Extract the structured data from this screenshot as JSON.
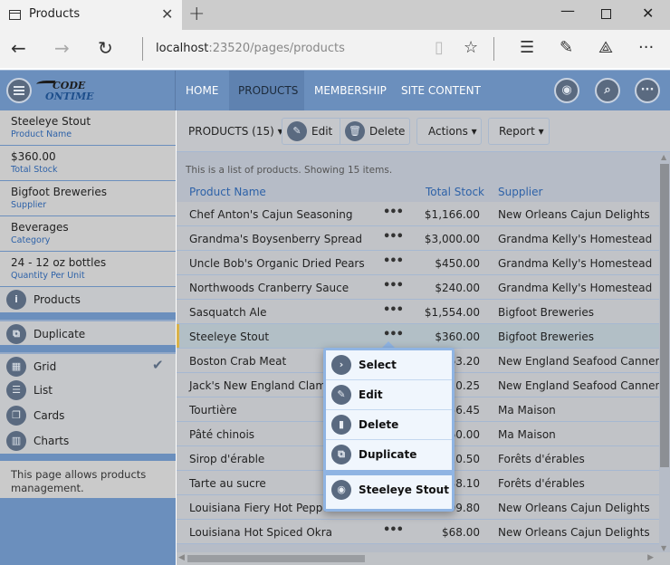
{
  "browser": {
    "tab_title": "Products",
    "tab_close": "✕",
    "new_tab": "+",
    "url_host": "localhost",
    "url_path": ":23520/pages/products",
    "icons": [
      "back-arrow-icon",
      "forward-arrow-icon",
      "refresh-icon",
      "reading-view-icon",
      "favorite-star-icon",
      "hub-icon",
      "web-note-icon",
      "share-icon",
      "more-icon"
    ]
  },
  "header": {
    "logo_line1": "CODE",
    "logo_line2": "ONTIME",
    "nav": [
      {
        "label": "HOME",
        "active": false
      },
      {
        "label": "PRODUCTS",
        "active": true
      },
      {
        "label": "MEMBERSHIP",
        "active": false
      },
      {
        "label": "SITE CONTENT",
        "active": false
      }
    ]
  },
  "sidebar": {
    "fields": [
      {
        "value": "Steeleye Stout",
        "label": "Product Name"
      },
      {
        "value": "$360.00",
        "label": "Total Stock"
      },
      {
        "value": "Bigfoot Breweries",
        "label": "Supplier"
      },
      {
        "value": "Beverages",
        "label": "Category"
      },
      {
        "value": "24 - 12 oz bottles",
        "label": "Quantity Per Unit"
      }
    ],
    "context_item": "Products",
    "action_item": "Duplicate",
    "views": [
      {
        "label": "Grid",
        "checked": true
      },
      {
        "label": "List",
        "checked": false
      },
      {
        "label": "Cards",
        "checked": false
      },
      {
        "label": "Charts",
        "checked": false
      }
    ],
    "description": "This page allows products management."
  },
  "toolbar": {
    "title": "PRODUCTS (15) ▾",
    "edit": "Edit",
    "delete": "Delete",
    "actions": "Actions ▾",
    "report": "Report ▾"
  },
  "grid": {
    "description": "This is a list of products. Showing 15 items.",
    "columns": {
      "name": "Product Name",
      "stock": "Total Stock",
      "supplier": "Supplier"
    },
    "rows": [
      {
        "name": "Chef Anton's Cajun Seasoning",
        "stock": "$1,166.00",
        "supplier": "New Orleans Cajun Delights"
      },
      {
        "name": "Grandma's Boysenberry Spread",
        "stock": "$3,000.00",
        "supplier": "Grandma Kelly's Homestead"
      },
      {
        "name": "Uncle Bob's Organic Dried Pears",
        "stock": "$450.00",
        "supplier": "Grandma Kelly's Homestead"
      },
      {
        "name": "Northwoods Cranberry Sauce",
        "stock": "$240.00",
        "supplier": "Grandma Kelly's Homestead"
      },
      {
        "name": "Sasquatch Ale",
        "stock": "$1,554.00",
        "supplier": "Bigfoot Breweries"
      },
      {
        "name": "Steeleye Stout",
        "stock": "$360.00",
        "supplier": "Bigfoot Breweries",
        "selected": true
      },
      {
        "name": "Boston Crab Meat",
        "stock": "263.20",
        "supplier": "New England Seafood Cannery"
      },
      {
        "name": "Jack's New England Clam Chowder",
        "stock": "820.25",
        "supplier": "New England Seafood Cannery"
      },
      {
        "name": "Tourtière",
        "stock": "156.45",
        "supplier": "Ma Maison"
      },
      {
        "name": "Pâté chinois",
        "stock": "760.00",
        "supplier": "Ma Maison"
      },
      {
        "name": "Sirop d'érable",
        "stock": "220.50",
        "supplier": "Forêts d'érables"
      },
      {
        "name": "Tarte au sucre",
        "stock": "338.10",
        "supplier": "Forêts d'érables"
      },
      {
        "name": "Louisiana Fiery Hot Pepper Sauce",
        "stock": "599.80",
        "supplier": "New Orleans Cajun Delights"
      },
      {
        "name": "Louisiana Hot Spiced Okra",
        "stock": "$68.00",
        "supplier": "New Orleans Cajun Delights"
      }
    ],
    "row_menu_glyph": "•••"
  },
  "popup": {
    "items": [
      {
        "label": "Select",
        "icon": "chevron-right-icon"
      },
      {
        "label": "Edit",
        "icon": "pencil-icon"
      },
      {
        "label": "Delete",
        "icon": "trash-icon"
      },
      {
        "label": "Duplicate",
        "icon": "duplicate-icon"
      }
    ],
    "view_item": {
      "label": "Steeleye Stout",
      "icon": "eye-icon"
    }
  }
}
